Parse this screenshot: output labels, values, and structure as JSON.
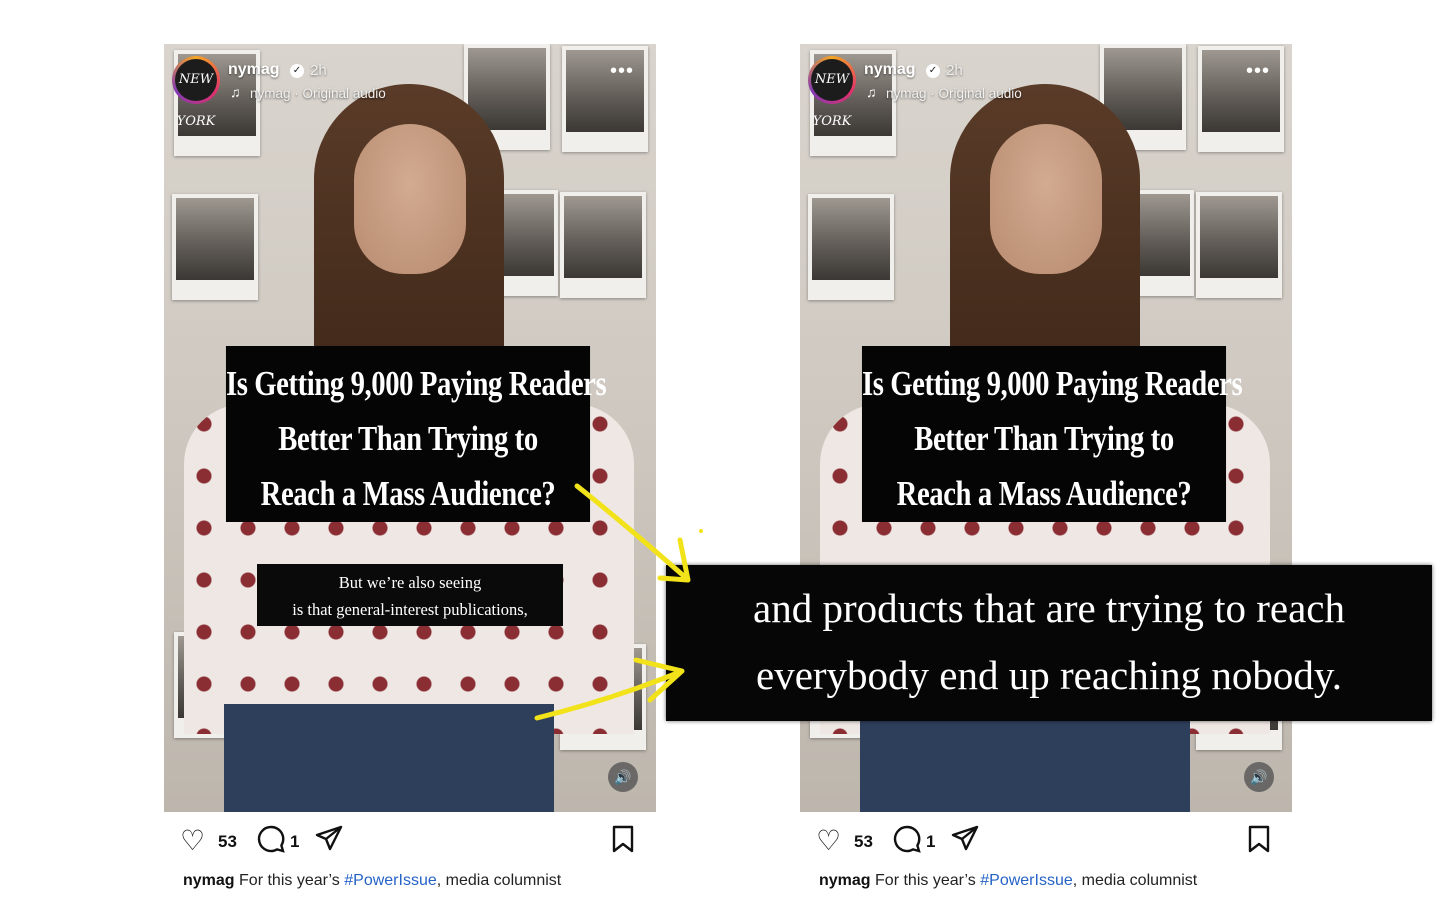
{
  "posts": [
    {
      "username": "nymag",
      "verified_icon": "verified-badge-icon",
      "time": "2h",
      "audio_icon": "music-note-icon",
      "audio_label": "nymag · Original audio",
      "logo_text": "NEW YORK",
      "headline_lines": [
        "Is Getting 9,000 Paying Readers",
        "Better Than Trying to",
        "Reach a Mass Audience?"
      ],
      "caption_lines": [
        "But we’re also seeing",
        "is that general-interest publications,"
      ],
      "likes": "53",
      "comments": "1",
      "desc_username": "nymag",
      "desc_pre": "For this year’s ",
      "desc_tag": "#PowerIssue",
      "desc_post": ", media columnist"
    },
    {
      "username": "nymag",
      "verified_icon": "verified-badge-icon",
      "time": "2h",
      "audio_icon": "music-note-icon",
      "audio_label": "nymag · Original audio",
      "logo_text": "NEW YORK",
      "headline_lines": [
        "Is Getting 9,000 Paying Readers",
        "Better Than Trying to",
        "Reach a Mass Audience?"
      ],
      "likes": "53",
      "comments": "1",
      "desc_username": "nymag",
      "desc_pre": "For this year’s ",
      "desc_tag": "#PowerIssue",
      "desc_post": ", media columnist"
    }
  ],
  "zoom_caption_lines": [
    "and products that are trying to reach",
    "everybody end up reaching nobody."
  ],
  "colors": {
    "arrow": "#f2e21a",
    "hashtag": "#2563c7",
    "caption_bg": "#060606"
  },
  "icons": [
    "heart-icon",
    "comment-icon",
    "share-icon",
    "bookmark-icon",
    "more-icon",
    "speaker-icon"
  ]
}
